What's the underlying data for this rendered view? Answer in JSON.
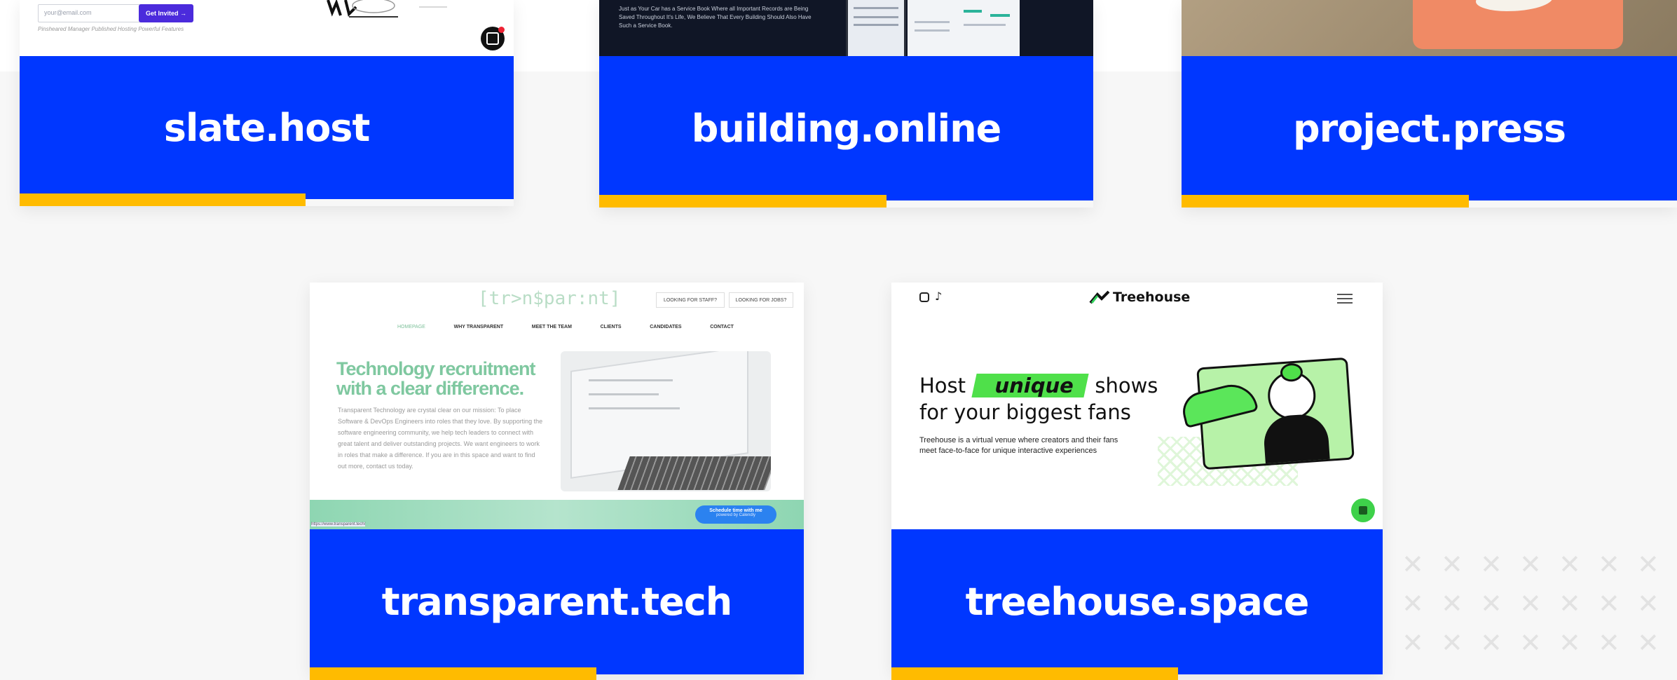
{
  "colors": {
    "label_bg": "#0037ff",
    "accent": "#ffbb00",
    "page_bg": "#f7f7f7"
  },
  "cards": [
    {
      "id": "slate",
      "label": "slate.host",
      "screenshot": {
        "email_placeholder": "your@email.com",
        "cta": "Get Invited →",
        "features": "Pinsheared Manager  Published Hosting  Powerful Features"
      }
    },
    {
      "id": "building",
      "label": "building.online",
      "screenshot": {
        "blurb_1": "Just as Your Car has a Service Book Where all Important Records are Being",
        "blurb_2": "Saved Throughout It's Life, We Believe That Every Building Should Also Have",
        "blurb_3": "Such a Service Book."
      }
    },
    {
      "id": "project",
      "label": "project.press"
    },
    {
      "id": "transparent",
      "label": "transparent.tech",
      "screenshot": {
        "logo": "[tr>n$par:nt]",
        "btn_staff": "LOOKING FOR STAFF?",
        "btn_job": "LOOKING FOR JOBS?",
        "nav": [
          "HOMEPAGE",
          "WHY TRANSPARENT",
          "MEET THE TEAM",
          "CLIENTS",
          "CANDIDATES",
          "CONTACT"
        ],
        "headline_1": "Technology recruitment",
        "headline_2": "with a clear difference.",
        "body": "Transparent Technology are crystal clear on our mission: To place Software & DevOps Engineers into roles that they love. By supporting the software engineering community, we help tech leaders to connect with great talent and deliver outstanding projects. We want engineers to work in roles that make a difference. If you are in this space and want to find out more, contact us today.",
        "schedule_1": "Schedule time with me",
        "schedule_2": "powered by Calendly",
        "url": "https://www.transparent.tech/"
      }
    },
    {
      "id": "treehouse",
      "label": "treehouse.space",
      "screenshot": {
        "brand": "Treehouse",
        "hero_host": "Host",
        "hero_unique": "unique",
        "hero_shows": "shows",
        "hero_line2": "for your biggest fans",
        "sub_1": "Treehouse is a virtual venue where creators and their fans",
        "sub_2": "meet face-to-face for unique interactive experiences"
      }
    }
  ]
}
